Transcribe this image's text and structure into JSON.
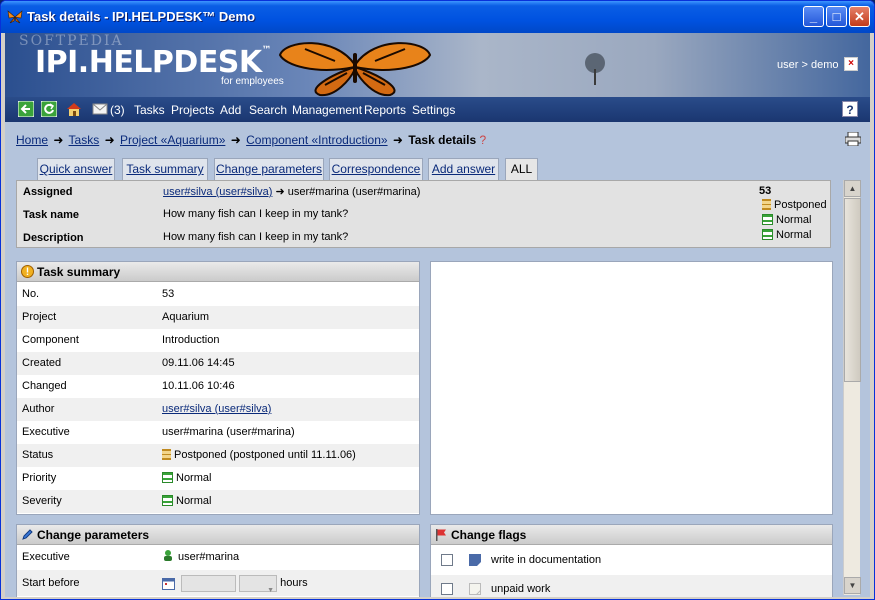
{
  "window": {
    "title": "Task details - IPI.HELPDESK™ Demo"
  },
  "banner": {
    "watermark": "SOFTPEDIA",
    "logo": "IPI.HELPDESK",
    "logo_tm": "™",
    "logo_sub": "for employees",
    "user": "user",
    "user_sep": ">",
    "user_name": "demo"
  },
  "nav": {
    "mail_count": "(3)",
    "items": [
      "Tasks",
      "Projects",
      "Add",
      "Search",
      "Management",
      "Reports",
      "Settings"
    ],
    "help": "?"
  },
  "breadcrumb": {
    "items": [
      "Home",
      "Tasks",
      "Project «Aquarium»",
      "Component «Introduction»"
    ],
    "current": "Task details",
    "hint": "?"
  },
  "tabs": [
    "Quick answer",
    "Task summary",
    "Change parameters",
    "Correspondence",
    "Add answer",
    "ALL"
  ],
  "overview": {
    "assigned_label": "Assigned",
    "assigned_from": "user#silva (user#silva)",
    "assigned_to": "user#marina (user#marina)",
    "task_name_label": "Task name",
    "task_name": "How many fish can I keep in my tank?",
    "description_label": "Description",
    "description": "How many fish can I keep in my tank?",
    "number": "53",
    "status": "Postponed",
    "priority": "Normal",
    "severity": "Normal"
  },
  "task_summary": {
    "title": "Task summary",
    "rows": [
      {
        "k": "No.",
        "v": "53"
      },
      {
        "k": "Project",
        "v": "Aquarium"
      },
      {
        "k": "Component",
        "v": "Introduction"
      },
      {
        "k": "Created",
        "v": "09.11.06 14:45"
      },
      {
        "k": "Changed",
        "v": "10.11.06 10:46"
      },
      {
        "k": "Author",
        "v": "user#silva (user#silva)"
      },
      {
        "k": "Executive",
        "v": "user#marina (user#marina)"
      },
      {
        "k": "Status",
        "v": "Postponed (postponed until 11.11.06)"
      },
      {
        "k": "Priority",
        "v": "Normal"
      },
      {
        "k": "Severity",
        "v": "Normal"
      }
    ]
  },
  "change_parameters": {
    "title": "Change parameters",
    "executive_label": "Executive",
    "executive_value": "user#marina",
    "start_label": "Start before",
    "hours_label": "hours"
  },
  "change_flags": {
    "title": "Change flags",
    "flags": [
      "write in documentation",
      "unpaid work"
    ]
  },
  "colors": {
    "titlebar": "#0054e3",
    "nav": "#1a3670",
    "content_bg": "#b4c4dc",
    "link": "#0a2a7a"
  }
}
